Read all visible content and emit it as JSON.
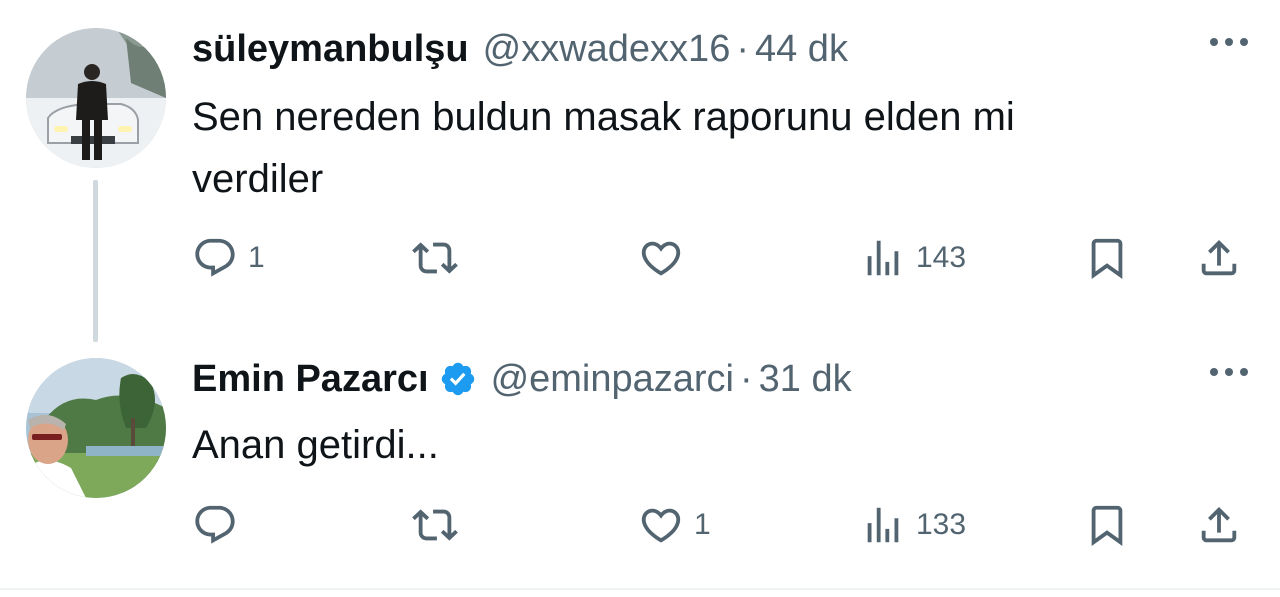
{
  "tweets": [
    {
      "author_name": "süleymanbulşu",
      "handle": "@xxwadexx16",
      "separator": "·",
      "time": "44 dk",
      "text": "Sen nereden buldun masak raporunu elden mi\nverdiler",
      "verified": false,
      "avatar": "user-avatar-man-car-snow",
      "stats": {
        "replies": "1",
        "retweets": "",
        "likes": "",
        "views": "143"
      }
    },
    {
      "author_name": "Emin Pazarcı",
      "handle": "@eminpazarci",
      "separator": "·",
      "time": "31 dk",
      "text": "Anan getirdi...",
      "verified": true,
      "avatar": "user-avatar-man-outdoors",
      "stats": {
        "replies": "",
        "retweets": "",
        "likes": "1",
        "views": "133"
      }
    }
  ],
  "icons": {
    "reply": "reply-icon",
    "retweet": "retweet-icon",
    "like": "heart-icon",
    "views": "views-icon",
    "bookmark": "bookmark-icon",
    "share": "share-icon",
    "more": "more-icon",
    "verified": "verified-badge-icon"
  },
  "colors": {
    "text": "#0f1419",
    "secondary": "#536471",
    "verified": "#1d9bf0",
    "thread_line": "#cfd9de",
    "background": "#ffffff"
  }
}
